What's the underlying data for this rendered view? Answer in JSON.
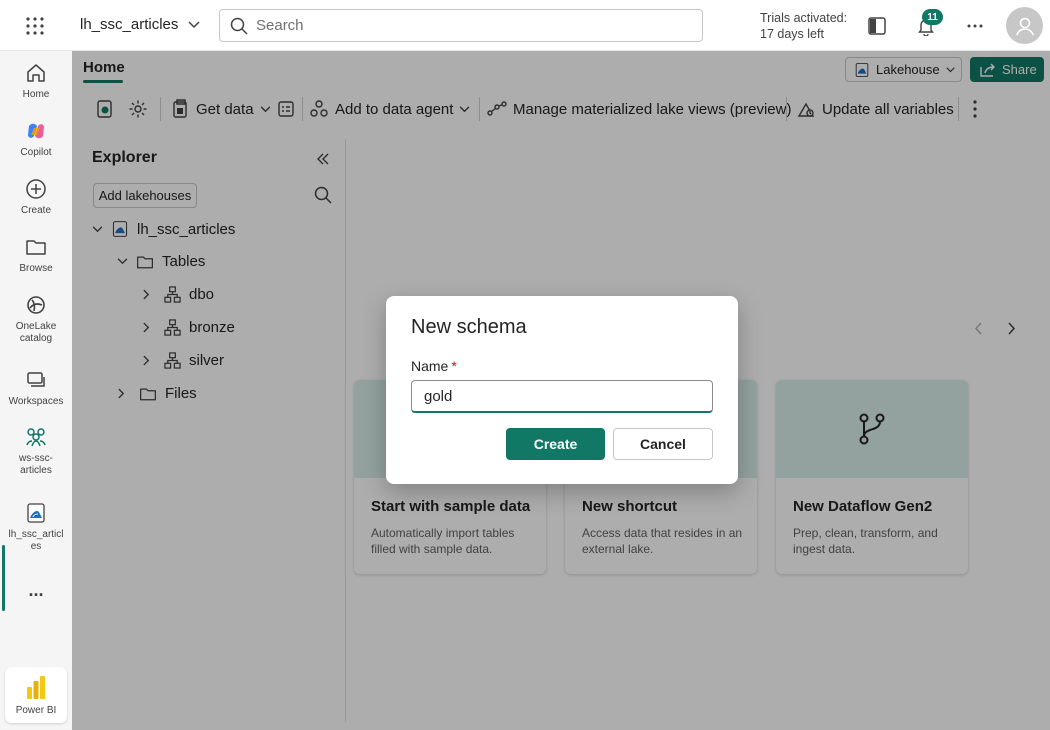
{
  "topbar": {
    "workspace_name": "lh_ssc_articles",
    "search_placeholder": "Search",
    "trial_line1": "Trials activated:",
    "trial_line2": "17 days left",
    "notification_count": "11"
  },
  "rail": {
    "items": [
      {
        "label": "Home",
        "icon": "home-icon"
      },
      {
        "label": "Copilot",
        "icon": "copilot-icon"
      },
      {
        "label": "Create",
        "icon": "create-icon"
      },
      {
        "label": "Browse",
        "icon": "folder-icon"
      },
      {
        "label": "OneLake catalog",
        "icon": "onelake-icon"
      },
      {
        "label": "Workspaces",
        "icon": "workspaces-icon"
      },
      {
        "label": "ws-ssc-articles",
        "icon": "workspace-group-icon"
      },
      {
        "label": "lh_ssc_articles",
        "icon": "lakehouse-icon"
      }
    ],
    "more_label": "...",
    "powerbi_label": "Power BI"
  },
  "header": {
    "home_tab": "Home",
    "lakehouse_label": "Lakehouse",
    "share_label": "Share"
  },
  "ribbon": {
    "get_data": "Get data",
    "add_to_agent": "Add to data agent",
    "manage_views": "Manage materialized lake views (preview)",
    "update_vars": "Update all variables"
  },
  "explorer": {
    "title": "Explorer",
    "add_lakehouses": "Add lakehouses",
    "tree": {
      "root": "lh_ssc_articles",
      "tables": "Tables",
      "schemas": [
        "dbo",
        "bronze",
        "silver"
      ],
      "files": "Files"
    }
  },
  "cards": [
    {
      "title": "Start with sample data",
      "desc": "Automatically import tables filled with sample data."
    },
    {
      "title": "New shortcut",
      "desc": "Access data that resides in an external lake."
    },
    {
      "title": "New Dataflow Gen2",
      "desc": "Prep, clean, transform, and ingest data."
    }
  ],
  "dialog": {
    "title": "New schema",
    "name_label": "Name",
    "required_mark": "*",
    "name_value": "gold",
    "create_label": "Create",
    "cancel_label": "Cancel"
  },
  "colors": {
    "accent": "#117865",
    "card_header": "#d9efea"
  }
}
